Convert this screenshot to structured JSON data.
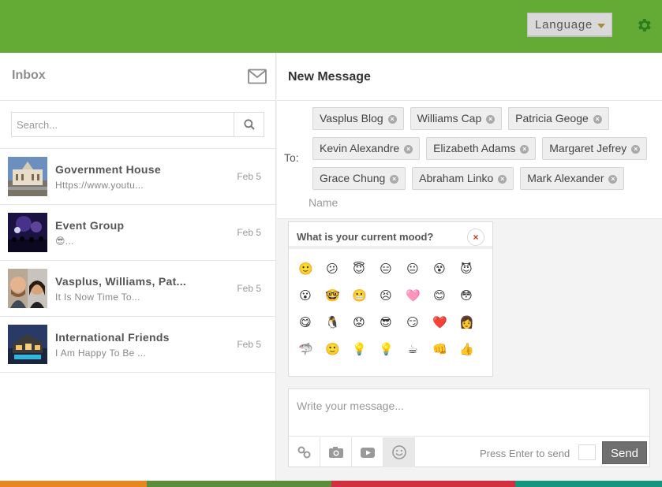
{
  "header": {
    "language_label": "Language",
    "colors": {
      "bar": "#64ab35",
      "settings_icon": "#2e7d1f"
    },
    "settings_icon": "gear-icon"
  },
  "inbox": {
    "title": "Inbox",
    "compose_icon": "envelope-icon",
    "search_placeholder": "Search...",
    "search_icon": "search-icon",
    "conversations": [
      {
        "name": "Government House",
        "preview": "Https://www.youtu...",
        "date": "Feb 5",
        "thumb": "government-house-photo"
      },
      {
        "name": "Event Group",
        "preview": "😎...",
        "date": "Feb 5",
        "thumb": "concert-photo"
      },
      {
        "name": "Vasplus, Williams, Pat...",
        "preview": "It Is Now Time To...",
        "date": "Feb 5",
        "thumb": "two-people-photo"
      },
      {
        "name": "International Friends",
        "preview": "I Am Happy To Be ...",
        "date": "Feb 5",
        "thumb": "house-photo"
      }
    ]
  },
  "compose": {
    "title": "New Message",
    "to_label": "To:",
    "recipients": [
      [
        "Vasplus Blog",
        "Williams Cap",
        "Patricia Geoge"
      ],
      [
        "Kevin Alexandre",
        "Elizabeth Adams",
        "Margaret Jefrey"
      ],
      [
        "Grace Chung",
        "Abraham Linko",
        "Mark Alexander"
      ]
    ],
    "remove_glyph": "×",
    "name_placeholder": "Name",
    "message_placeholder": "Write your message...",
    "press_enter_label": "Press Enter to send",
    "send_label": "Send",
    "tools": [
      "link-icon",
      "camera-icon",
      "video-icon",
      "emoji-icon"
    ]
  },
  "mood": {
    "title": "What is your current mood?",
    "close_glyph": "×",
    "emojis": [
      [
        "🙂",
        "😕",
        "😇",
        "😑",
        "😐",
        "😵",
        "😈"
      ],
      [
        "😮",
        "🤓",
        "😬",
        "😣",
        "🩷",
        "😊",
        "😳"
      ],
      [
        "😋",
        "🐧",
        "😟",
        "😎",
        "😏",
        "❤️",
        "👩"
      ],
      [
        "🦈",
        "🙂",
        "💡",
        "💡",
        "☕",
        "👊",
        "👍"
      ]
    ]
  },
  "footer_strip": [
    "#e6871f",
    "#5c8e3a",
    "#d3303f",
    "#15977f"
  ]
}
